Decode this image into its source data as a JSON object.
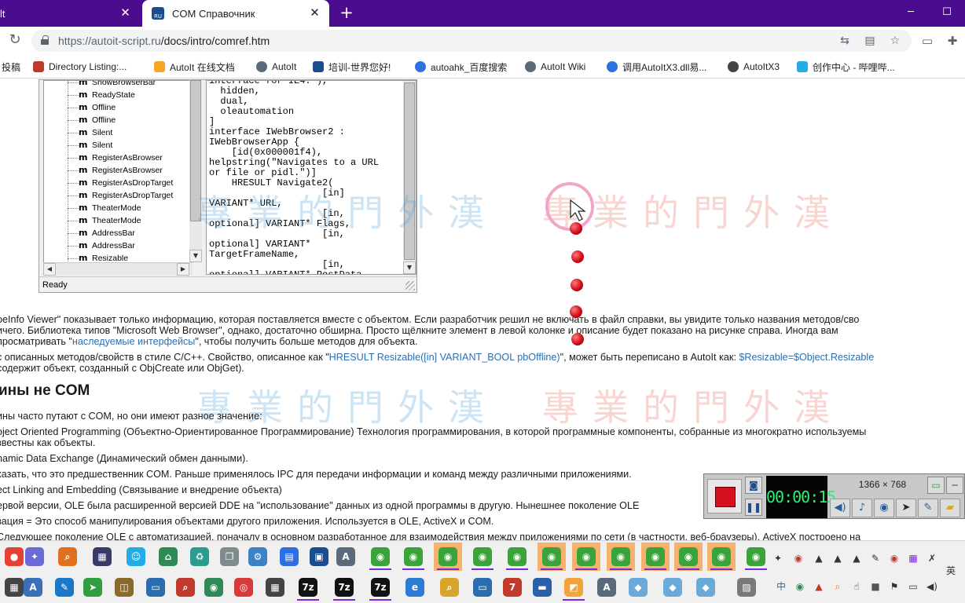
{
  "browser": {
    "tabs": [
      {
        "label": "lt",
        "active": false
      },
      {
        "label": "COM Справочник",
        "active": true
      }
    ],
    "new_tab": "+",
    "url_host": "https://autoit-script.ru",
    "url_path": "/docs/intro/comref.htm",
    "bookmarks": [
      {
        "label": "投稿",
        "color": "#e05c2c"
      },
      {
        "label": "Directory Listing:...",
        "color": "#c0392b"
      },
      {
        "label": "AutoIt 在线文档",
        "color": "#f5a623"
      },
      {
        "label": "AutoIt",
        "color": "#5b6a7a"
      },
      {
        "label": "培训-世界您好!",
        "color": "#1b4c8f"
      },
      {
        "label": "autoahk_百度搜索",
        "color": "#2f6fe4"
      },
      {
        "label": "AutoIt Wiki",
        "color": "#5b6a7a"
      },
      {
        "label": "调用AutoItX3.dll易...",
        "color": "#2f6fe4"
      },
      {
        "label": "AutoItX3",
        "color": "#444444"
      },
      {
        "label": "创作中心 - 哔哩哔...",
        "color": "#23ade5"
      }
    ]
  },
  "oleview": {
    "tree_items": [
      "ShowBrowserBar",
      "ReadyState",
      "Offline",
      "Offline",
      "Silent",
      "Silent",
      "RegisterAsBrowser",
      "RegisterAsBrowser",
      "RegisterAsDropTarget",
      "RegisterAsDropTarget",
      "TheaterMode",
      "TheaterMode",
      "AddressBar",
      "AddressBar",
      "Resizable"
    ],
    "tree_marker": "m",
    "code_lines": [
      "interface for IE4.\"),",
      "  hidden,",
      "  dual,",
      "  oleautomation",
      "]",
      "interface IWebBrowser2 :",
      "IWebBrowserApp {",
      "    [id(0x000001f4),",
      "helpstring(\"Navigates to a URL",
      "or file or pidl.\")]",
      "    HRESULT Navigate2(",
      "                    [in]",
      "VARIANT* URL,",
      "                    [in,",
      "optional] VARIANT* Flags,",
      "                    [in,",
      "optional] VARIANT*",
      "TargetFrameName,",
      "                    [in,",
      "optional] VARIANT* PostData,"
    ],
    "status": "Ready"
  },
  "article": {
    "p1": [
      {
        "text": "peInfo Viewer\" показывает только информацию, которая поставляется вместе с объектом. Если разработчик решил не включать в файл справки, вы увидите только названия методов/сво"
      },
      {
        "text": "ичего. Библиотека типов \"Microsoft Web Browser\", однако, достаточно обширна. Просто щёлкните элемент в левой колонке и описание будет показано на рисунке справа. Иногда вам"
      }
    ],
    "p1_line3_before": "просматривать \"",
    "p1_line3_link": "наследуемые интерфейсы",
    "p1_line3_after": "\", чтобы получить больше методов для объекта.",
    "p2_line1_before": "с описанных методов/свойств в стиле C/C++. Свойство, описанное как \"",
    "p2_line1_link": "HRESULT Resizable([in] VARIANT_BOOL pbOffline)",
    "p2_line1_mid": "\", может быть переписано в AutoIt как: ",
    "p2_line1_link2": "$Resizable=$Object.Resizable",
    "p2_line2": "содержит объект, созданный с ObjCreate или ObjGet).",
    "heading": "ины не COM",
    "lines": [
      "ины часто путают с COM, но они имеют разное значение:",
      "oject Oriented Programming (Объектно-Ориентированное Программирование) Технология программирования, в которой программные компоненты, собранные из многократно используемы",
      "звестны как объекты.",
      "namic Data Exchange (Динамический обмен данными).",
      "казать, что это предшественник COM. Раньше применялось IPC для передачи информации и команд между различными приложениями.",
      "ect Linking and Embedding (Связывание и внедрение объекта)",
      "ервой версии, OLE была расширенной версией DDE на \"использование\" данных из одной программы в другую. Нынешнее поколение OLE",
      "зация = Это способ манипулирования объектами другого приложения. Используется в OLE, ActiveX и COM.",
      "Следующее поколение OLE с автоматизацией, поначалу в основном разработанное для взаимодействия между приложениями по сети (в частности, веб-браузеры). ActiveX построено на"
    ],
    "watermark": "專業的門外漢",
    "watermark_colors": [
      "#4aa0d8",
      "#e86a5a"
    ]
  },
  "recorder": {
    "timer": "00:00:15",
    "resolution": "1366 × 768",
    "accent": "#d6101e"
  },
  "taskbar": {
    "row1": [
      {
        "name": "chrome-icon",
        "color": "#e34133",
        "glyph": "●",
        "hl": false
      },
      {
        "name": "rocket-icon",
        "color": "#6a6ad8",
        "glyph": "✦",
        "hl": false
      },
      {
        "name": "search-tool-icon",
        "color": "#e07020",
        "glyph": "⌕",
        "hl": false
      },
      {
        "name": "film-icon",
        "color": "#3a3a6a",
        "glyph": "▦",
        "hl": false
      },
      {
        "name": "bilibili-icon",
        "color": "#23ade5",
        "glyph": "☺",
        "hl": false
      },
      {
        "name": "network-icon",
        "color": "#2e8b57",
        "glyph": "⌂",
        "hl": false
      },
      {
        "name": "recycle-icon",
        "color": "#2a9d8f",
        "glyph": "♻",
        "hl": false
      },
      {
        "name": "copy-icon",
        "color": "#7f8c8d",
        "glyph": "❐",
        "hl": false
      },
      {
        "name": "settings-icon",
        "color": "#3b82c4",
        "glyph": "⚙",
        "hl": false
      },
      {
        "name": "database-icon",
        "color": "#2f6fe4",
        "glyph": "▤",
        "hl": false
      },
      {
        "name": "computer-icon",
        "color": "#1b4c8f",
        "glyph": "▣",
        "hl": false
      },
      {
        "name": "autoit-icon",
        "color": "#5b6a7a",
        "glyph": "A",
        "hl": false
      },
      {
        "name": "globe-icon",
        "color": "#3aa33a",
        "glyph": "◉",
        "hl": false
      },
      {
        "name": "globe-icon",
        "color": "#3aa33a",
        "glyph": "◉",
        "hl": false
      },
      {
        "name": "globe-icon",
        "color": "#3aa33a",
        "glyph": "◉",
        "hl": true
      },
      {
        "name": "globe-icon",
        "color": "#3aa33a",
        "glyph": "◉",
        "hl": false
      },
      {
        "name": "globe-icon",
        "color": "#3aa33a",
        "glyph": "◉",
        "hl": false
      },
      {
        "name": "globe-icon",
        "color": "#3aa33a",
        "glyph": "◉",
        "hl": true
      },
      {
        "name": "globe-icon",
        "color": "#3aa33a",
        "glyph": "◉",
        "hl": true
      },
      {
        "name": "globe-icon",
        "color": "#3aa33a",
        "glyph": "◉",
        "hl": true
      },
      {
        "name": "globe-icon",
        "color": "#3aa33a",
        "glyph": "◉",
        "hl": true
      },
      {
        "name": "globe-icon",
        "color": "#3aa33a",
        "glyph": "◉",
        "hl": true
      },
      {
        "name": "globe-icon",
        "color": "#3aa33a",
        "glyph": "◉",
        "hl": true
      },
      {
        "name": "globe-icon",
        "color": "#3aa33a",
        "glyph": "◉",
        "hl": false
      }
    ],
    "row2": [
      {
        "name": "calculator-icon",
        "color": "#444",
        "glyph": "▦"
      },
      {
        "name": "autoit-editor-icon",
        "color": "#3b6fb6",
        "glyph": "A"
      },
      {
        "name": "script-icon",
        "color": "#1b78c8",
        "glyph": "✎"
      },
      {
        "name": "arrow-app-icon",
        "color": "#2e9e3e",
        "glyph": "➤"
      },
      {
        "name": "package-icon",
        "color": "#8a6a2a",
        "glyph": "◫"
      },
      {
        "name": "window-icon",
        "color": "#2b6cb0",
        "glyph": "▭"
      },
      {
        "name": "magnifier-icon",
        "color": "#c0392b",
        "glyph": "⌕"
      },
      {
        "name": "globe-icon",
        "color": "#2e8b57",
        "glyph": "◉"
      },
      {
        "name": "weibo-icon",
        "color": "#d63a3a",
        "glyph": "◎"
      },
      {
        "name": "calendar-icon",
        "color": "#444",
        "glyph": "▦"
      },
      {
        "name": "7zip-icon",
        "color": "#111",
        "glyph": "7z"
      },
      {
        "name": "7zip-icon",
        "color": "#111",
        "glyph": "7z"
      },
      {
        "name": "7zip-icon",
        "color": "#111",
        "glyph": "7z"
      },
      {
        "name": "ie-icon",
        "color": "#2b7cd3",
        "glyph": "e"
      },
      {
        "name": "folder-search-icon",
        "color": "#d8a52a",
        "glyph": "⌕"
      },
      {
        "name": "remote-icon",
        "color": "#2b6cb0",
        "glyph": "▭"
      },
      {
        "name": "java-icon",
        "color": "#c0392b",
        "glyph": "7"
      },
      {
        "name": "book-icon",
        "color": "#2b5fa8",
        "glyph": "▬"
      },
      {
        "name": "sticky-icon",
        "color": "#f2a43a",
        "glyph": "◩"
      },
      {
        "name": "autoit-icon",
        "color": "#5b6a7a",
        "glyph": "A"
      },
      {
        "name": "glass-icon",
        "color": "#6aaad8",
        "glyph": "◆"
      },
      {
        "name": "glass-icon",
        "color": "#6aaad8",
        "glyph": "◆"
      },
      {
        "name": "glass-icon",
        "color": "#6aaad8",
        "glyph": "◆"
      },
      {
        "name": "image-icon",
        "color": "#7a7a7a",
        "glyph": "▨"
      }
    ],
    "ime": "英",
    "ime2": "中"
  }
}
